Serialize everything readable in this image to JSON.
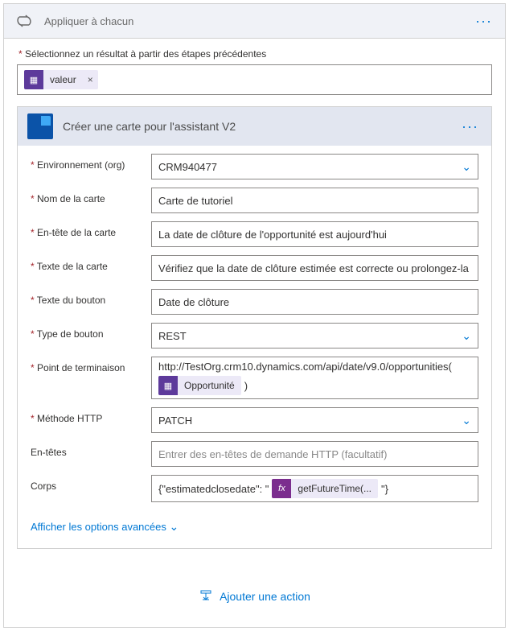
{
  "outer": {
    "title": "Appliquer à chacun",
    "menu_icon": "ellipsis-icon"
  },
  "previous_step": {
    "label": "Sélectionnez un résultat à partir des étapes précédentes",
    "token_label": "valeur"
  },
  "inner": {
    "title": "Créer une carte pour l'assistant V2",
    "menu_icon": "ellipsis-icon"
  },
  "fields": {
    "env": {
      "label": "Environnement (org)",
      "value": "CRM940477"
    },
    "card_name": {
      "label": "Nom de la carte",
      "value": "Carte de tutoriel"
    },
    "card_header": {
      "label": "En-tête de la carte",
      "value": "La date de clôture de l'opportunité est aujourd'hui"
    },
    "card_text": {
      "label": "Texte de la carte",
      "value": "Vérifiez que la date de clôture estimée est correcte ou prolongez-la"
    },
    "button_text": {
      "label": "Texte du bouton",
      "value": "Date de clôture"
    },
    "button_type": {
      "label": "Type de bouton",
      "value": "REST"
    },
    "endpoint": {
      "label": "Point de terminaison",
      "line1": "http://TestOrg.crm10.dynamics.com/api/date/v9.0/opportunities(",
      "token": "Opportunité",
      "line2_suffix": ")"
    },
    "http_method": {
      "label": "Méthode HTTP",
      "value": "PATCH"
    },
    "headers": {
      "label": "En-têtes",
      "placeholder": "Entrer des en-têtes de demande HTTP (facultatif)"
    },
    "body": {
      "label": "Corps",
      "prefix": "{\"estimatedclosedate\": \"",
      "expr_icon": "fx",
      "expr_label": "getFutureTime(...",
      "suffix": "\"}"
    }
  },
  "advanced": {
    "label": "Afficher les options avancées"
  },
  "add_action": {
    "label": "Ajouter une action"
  }
}
